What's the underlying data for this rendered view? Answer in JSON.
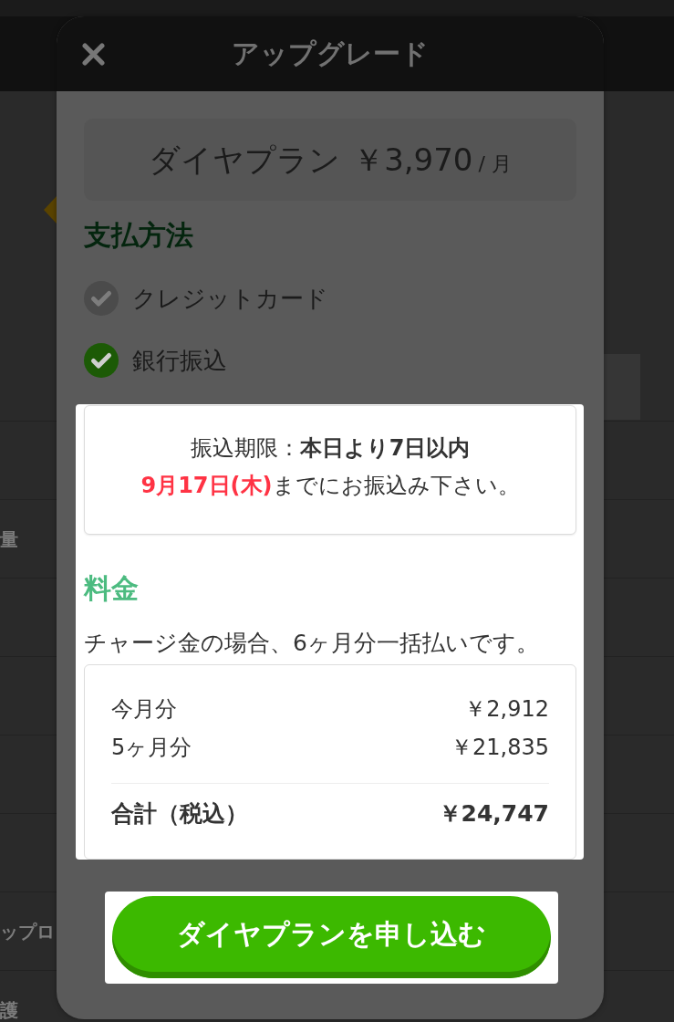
{
  "background_page": {
    "rows": [
      {},
      {
        "label": "量"
      },
      {},
      {},
      {},
      {},
      {
        "label": "ップロ"
      },
      {
        "label": "護"
      }
    ]
  },
  "dialog": {
    "title": "アップグレード"
  },
  "plan": {
    "name": "ダイヤプラン",
    "price": "￥3,970",
    "unit": "/ 月"
  },
  "payment_method": {
    "heading": "支払方法",
    "options": [
      {
        "label": "クレジットカード",
        "selected": false
      },
      {
        "label": "銀行振込",
        "selected": true
      }
    ]
  },
  "transfer_section": {
    "highlighted": true,
    "notice_lines": [
      {
        "kind": "term",
        "text": "振込期限：**本日より7日以内**"
      },
      {
        "kind": "deadline",
        "text": "**9月17日(木)**までにお振込み下さい。"
      }
    ],
    "fees": {
      "heading": "料金",
      "note": "チャージ金の場合、6ヶ月分一括払いです。",
      "items": [
        {
          "label": "今月分",
          "amount": "￥2,912"
        },
        {
          "label": "5ヶ月分",
          "amount": "￥21,835"
        }
      ],
      "total": {
        "label": "合計（税込）",
        "amount": "￥24,747"
      }
    }
  },
  "apply_button": {
    "label": "ダイヤプランを申し込む",
    "highlighted": true
  }
}
